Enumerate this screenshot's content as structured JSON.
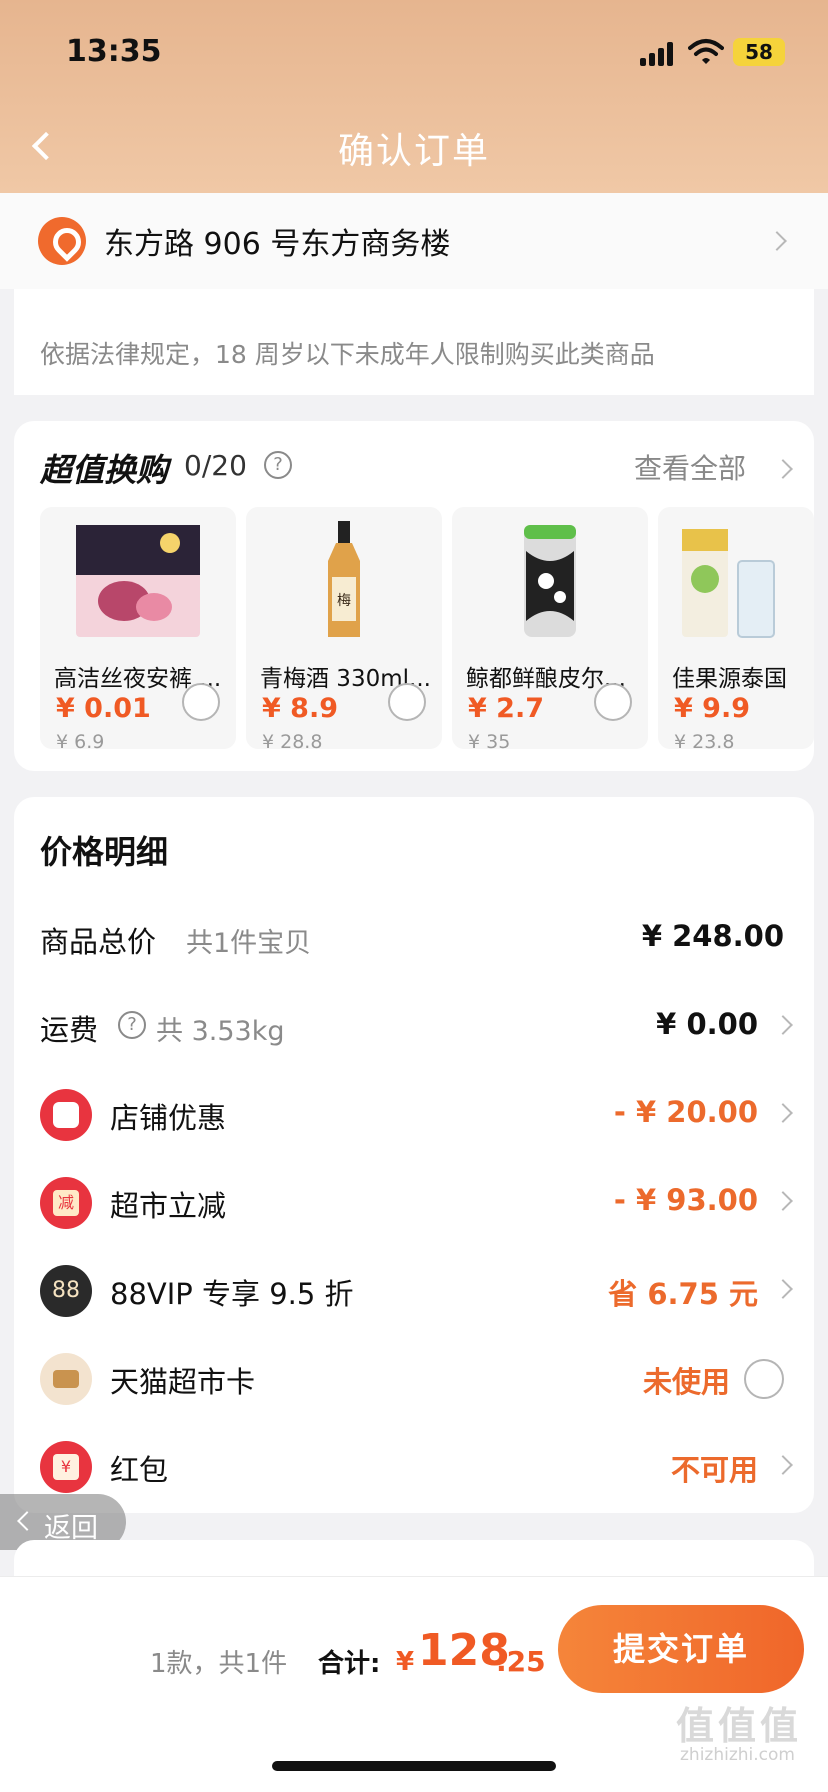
{
  "status_bar": {
    "time": "13:35",
    "battery": "58"
  },
  "nav": {
    "title": "确认订单"
  },
  "address": {
    "text": "东方路 906 号东方商务楼"
  },
  "notice": {
    "text": "依据法律规定，18 周岁以下未成年人限制购买此类商品"
  },
  "exchange": {
    "title": "超值换购",
    "count": "0/20",
    "help_icon": "?",
    "view_all": "查看全部",
    "products": [
      {
        "name": "高洁丝夜安裤 ...",
        "price": "¥ 0.01",
        "orig": "¥ 6.9",
        "image": "pink-pants-package"
      },
      {
        "name": "青梅酒 330ml...",
        "price": "¥ 8.9",
        "orig": "¥ 28.8",
        "image": "plum-wine-bottle"
      },
      {
        "name": "鲸都鲜酿皮尔...",
        "price": "¥ 2.7",
        "orig": "¥ 35",
        "image": "beer-can"
      },
      {
        "name": "佳果源泰国",
        "price": "¥ 9.9",
        "orig": "¥ 23.8",
        "image": "coconut-water-carton"
      }
    ]
  },
  "price_detail": {
    "title": "价格明细",
    "rows": [
      {
        "label": "商品总价",
        "sub": "共1件宝贝",
        "value": "¥ 248.00"
      },
      {
        "label": "运费",
        "sub": "共 3.53kg",
        "value": "¥ 0.00"
      },
      {
        "label": "店铺优惠",
        "value": "- ¥ 20.00",
        "icon": "ticket-icon"
      },
      {
        "label": "超市立减",
        "value": "- ¥ 93.00",
        "icon": "reduce-icon",
        "icon_text": "减"
      },
      {
        "label": "88VIP 专享 9.5 折",
        "value": "省 6.75 元",
        "icon": "88vip-icon",
        "icon_text": "88"
      },
      {
        "label": "天猫超市卡",
        "value": "未使用",
        "icon": "card-icon"
      },
      {
        "label": "红包",
        "value": "不可用",
        "icon": "red-packet-icon",
        "icon_text": "¥"
      }
    ]
  },
  "back_pill": {
    "label": "返回"
  },
  "bottom": {
    "count": "1款，共1件",
    "total_label": "合计:",
    "currency": "¥",
    "total_int": "128",
    "total_dec": ".25",
    "submit": "提交订单",
    "watermark": "值值值",
    "watermark_sub": "zhizhizhi.com"
  },
  "colors": {
    "accent": "#f05a24",
    "header": "#e6b58f",
    "button": "#f0662a"
  }
}
